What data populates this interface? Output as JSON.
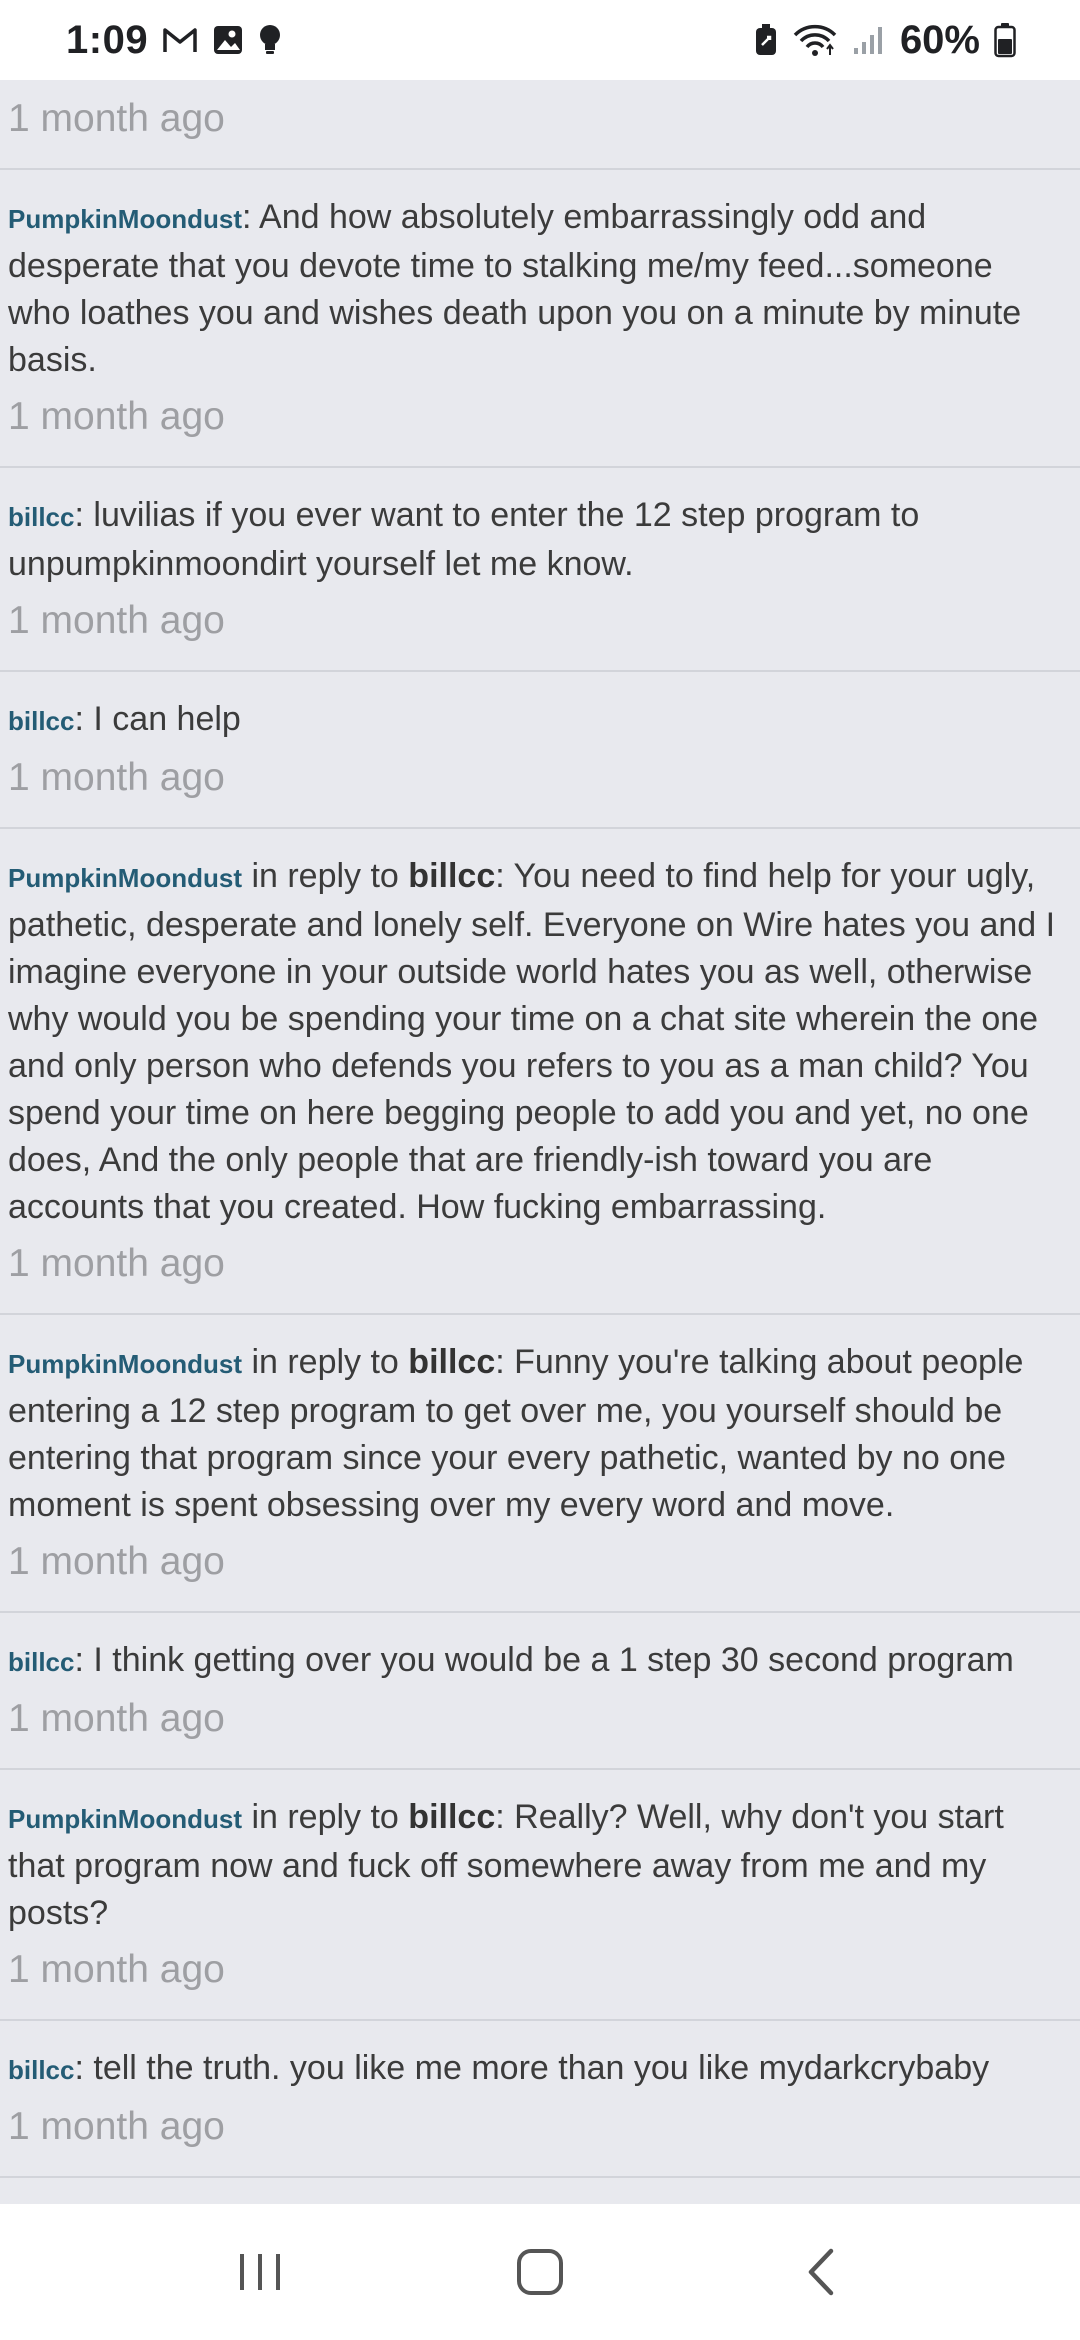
{
  "status_bar": {
    "time": "1:09",
    "battery_percent": "60%",
    "left_icons": [
      "gmail-icon",
      "gallery-icon",
      "bulb-icon"
    ],
    "right_icons": [
      "battery-saver-icon",
      "wifi-icon",
      "signal-icon",
      "battery-icon"
    ]
  },
  "feed": {
    "reply_word": "in reply to",
    "entries": [
      {
        "username": "",
        "reply_to": "",
        "text": "",
        "timestamp": "1 month ago"
      },
      {
        "username": "PumpkinMoondust",
        "reply_to": "",
        "text": "And how absolutely embarrassingly odd and desperate that you devote time to stalking me/my feed...someone who loathes you and wishes death upon you on a minute by minute basis.",
        "timestamp": "1 month ago"
      },
      {
        "username": "billcc",
        "reply_to": "",
        "text": "luvilias if you ever want to enter the 12 step program to unpumpkinmoondirt yourself let me know.",
        "timestamp": "1 month ago"
      },
      {
        "username": "billcc",
        "reply_to": "",
        "text": "I can help",
        "timestamp": "1 month ago"
      },
      {
        "username": "PumpkinMoondust",
        "reply_to": "billcc",
        "text": "You need to find help for your ugly, pathetic, desperate and lonely self. Everyone on Wire hates you and I imagine everyone in your outside world hates you as well, otherwise why would you be spending your time on a chat site wherein the one and only person who defends you refers to you as a man child? You spend your time on here begging people to add you and yet, no one does, And the only people that are friendly-ish toward you are accounts that you created. How fucking embarrassing.",
        "timestamp": "1 month ago"
      },
      {
        "username": "PumpkinMoondust",
        "reply_to": "billcc",
        "text": "Funny you're talking about people entering a 12 step program to get over me, you yourself should be entering that program since your every pathetic, wanted by no one moment is spent obsessing over my every word and move.",
        "timestamp": "1 month ago"
      },
      {
        "username": "billcc",
        "reply_to": "",
        "text": "I think getting over you would be a 1 step 30 second program",
        "timestamp": "1 month ago"
      },
      {
        "username": "PumpkinMoondust",
        "reply_to": "billcc",
        "text": "Really? Well, why don't you start that program now and fuck off somewhere away from me and my posts?",
        "timestamp": "1 month ago"
      },
      {
        "username": "billcc",
        "reply_to": "",
        "text": "tell the truth. you like me more than you like mydarkcrybaby",
        "timestamp": "1 month ago"
      }
    ]
  },
  "nav_bar": {
    "buttons": [
      "recent-apps-icon",
      "home-icon",
      "back-icon"
    ]
  },
  "colors": {
    "background": "#e8e9ee",
    "username": "#245c75",
    "timestamp": "#9e9fa3",
    "divider": "#d2d4da"
  }
}
